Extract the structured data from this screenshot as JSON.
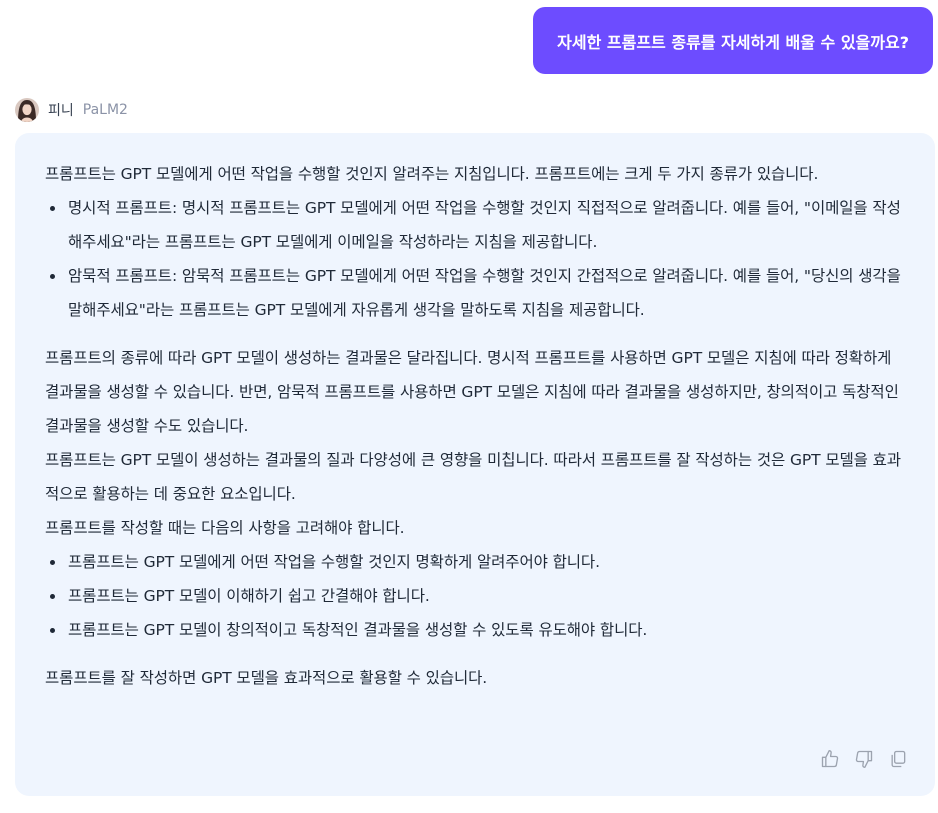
{
  "user_message": {
    "text": "자세한 프롬프트 종류를 자세하게 배울 수 있을까요?",
    "bubble_color": "#6d4cff"
  },
  "bot": {
    "name": "피니",
    "model": "PaLM2",
    "avatar_icon": "avatar-photo-icon"
  },
  "answer": {
    "intro": "프롬프트는 GPT 모델에게 어떤 작업을 수행할 것인지 알려주는 지침입니다. 프롬프트에는 크게 두 가지 종류가 있습니다.",
    "types": [
      "명시적 프롬프트: 명시적 프롬프트는 GPT 모델에게 어떤 작업을 수행할 것인지 직접적으로 알려줍니다. 예를 들어, \"이메일을 작성해주세요\"라는 프롬프트는 GPT 모델에게 이메일을 작성하라는 지침을 제공합니다.",
      "암묵적 프롬프트: 암묵적 프롬프트는 GPT 모델에게 어떤 작업을 수행할 것인지 간접적으로 알려줍니다. 예를 들어, \"당신의 생각을 말해주세요\"라는 프롬프트는 GPT 모델에게 자유롭게 생각을 말하도록 지침을 제공합니다."
    ],
    "para2": "프롬프트의 종류에 따라 GPT 모델이 생성하는 결과물은 달라집니다. 명시적 프롬프트를 사용하면 GPT 모델은 지침에 따라 정확하게 결과물을 생성할 수 있습니다. 반면, 암묵적 프롬프트를 사용하면 GPT 모델은 지침에 따라 결과물을 생성하지만, 창의적이고 독창적인 결과물을 생성할 수도 있습니다.",
    "para3": "프롬프트는 GPT 모델이 생성하는 결과물의 질과 다양성에 큰 영향을 미칩니다. 따라서 프롬프트를 잘 작성하는 것은 GPT 모델을 효과적으로 활용하는 데 중요한 요소입니다.",
    "para4": "프롬프트를 작성할 때는 다음의 사항을 고려해야 합니다.",
    "tips": [
      "프롬프트는 GPT 모델에게 어떤 작업을 수행할 것인지 명확하게 알려주어야 합니다.",
      "프롬프트는 GPT 모델이 이해하기 쉽고 간결해야 합니다.",
      "프롬프트는 GPT 모델이 창의적이고 독창적인 결과물을 생성할 수 있도록 유도해야 합니다."
    ],
    "closing": "프롬프트를 잘 작성하면 GPT 모델을 효과적으로 활용할 수 있습니다."
  },
  "actions": {
    "icons": [
      "thumbs-up-icon",
      "thumbs-down-icon",
      "copy-icon"
    ],
    "icon_color": "#9ca3af"
  },
  "colors": {
    "card_background": "#eff5fe",
    "text": "#1f2937",
    "model_label": "#8b93a7"
  }
}
